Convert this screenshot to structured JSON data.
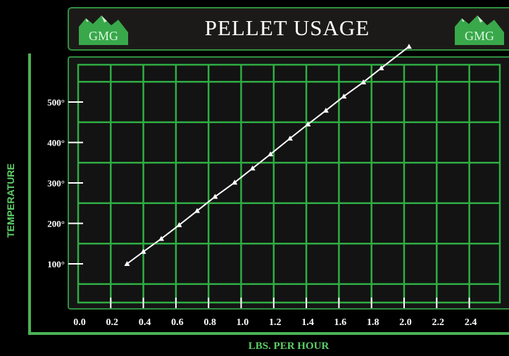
{
  "header": {
    "logo_text": "GMG"
  },
  "chart_data": {
    "type": "line",
    "title": "PELLET USAGE",
    "xlabel": "LBS. PER HOUR",
    "ylabel": "TEMPERATURE",
    "x_ticks": [
      "0.0",
      "0.2",
      "0.4",
      "0.6",
      "0.8",
      "1.0",
      "1.2",
      "1.4",
      "1.6",
      "1.8",
      "2.0",
      "2.2",
      "2.4"
    ],
    "y_ticks": [
      "100°",
      "200°",
      "300°",
      "400°",
      "500°"
    ],
    "xlim": [
      0.0,
      2.4
    ],
    "ylim": [
      100,
      500
    ],
    "grid": true,
    "series": [
      {
        "x": [
          0.3,
          0.4,
          0.51,
          0.62,
          0.73,
          0.84,
          0.96,
          1.07,
          1.18,
          1.3,
          1.41,
          1.52,
          1.63,
          1.75,
          1.86,
          2.03
        ],
        "y": [
          100,
          130,
          162,
          196,
          231,
          266,
          301,
          336,
          371,
          410,
          445,
          479,
          514,
          549,
          584,
          637
        ]
      }
    ],
    "colors": {
      "line": "#ffffff",
      "grid": "#2fae43",
      "axis": "#4ab255",
      "text": "#ffffff",
      "label": "#5ecf68"
    }
  }
}
